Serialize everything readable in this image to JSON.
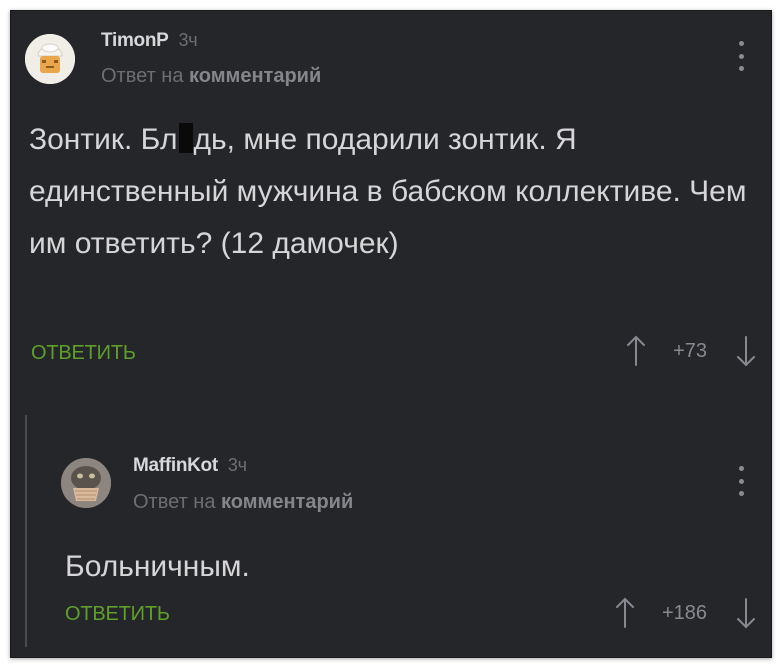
{
  "comments": [
    {
      "author": "TimonP",
      "time": "3ч",
      "reply_prefix": "Ответ на",
      "reply_target": "комментарий",
      "text_before_censor": "Зонтик. Бл",
      "text_after_censor": "дь, мне подарили зонтик. Я единственный мужчина в бабском коллективе. Чем им ответить? (12 дамочек)",
      "reply_label": "ОТВЕТИТЬ",
      "score": "+73"
    },
    {
      "author": "MaffinKot",
      "time": "3ч",
      "reply_prefix": "Ответ на",
      "reply_target": "комментарий",
      "text": "Больничным.",
      "reply_label": "ОТВЕТИТЬ",
      "score": "+186"
    }
  ],
  "colors": {
    "background": "#25262a",
    "accent_green": "#5fa02a",
    "text": "#d6d6d8",
    "muted": "#6d6e73"
  },
  "icons": {
    "menu": "kebab-menu-icon",
    "upvote": "arrow-up-icon",
    "downvote": "arrow-down-icon"
  }
}
